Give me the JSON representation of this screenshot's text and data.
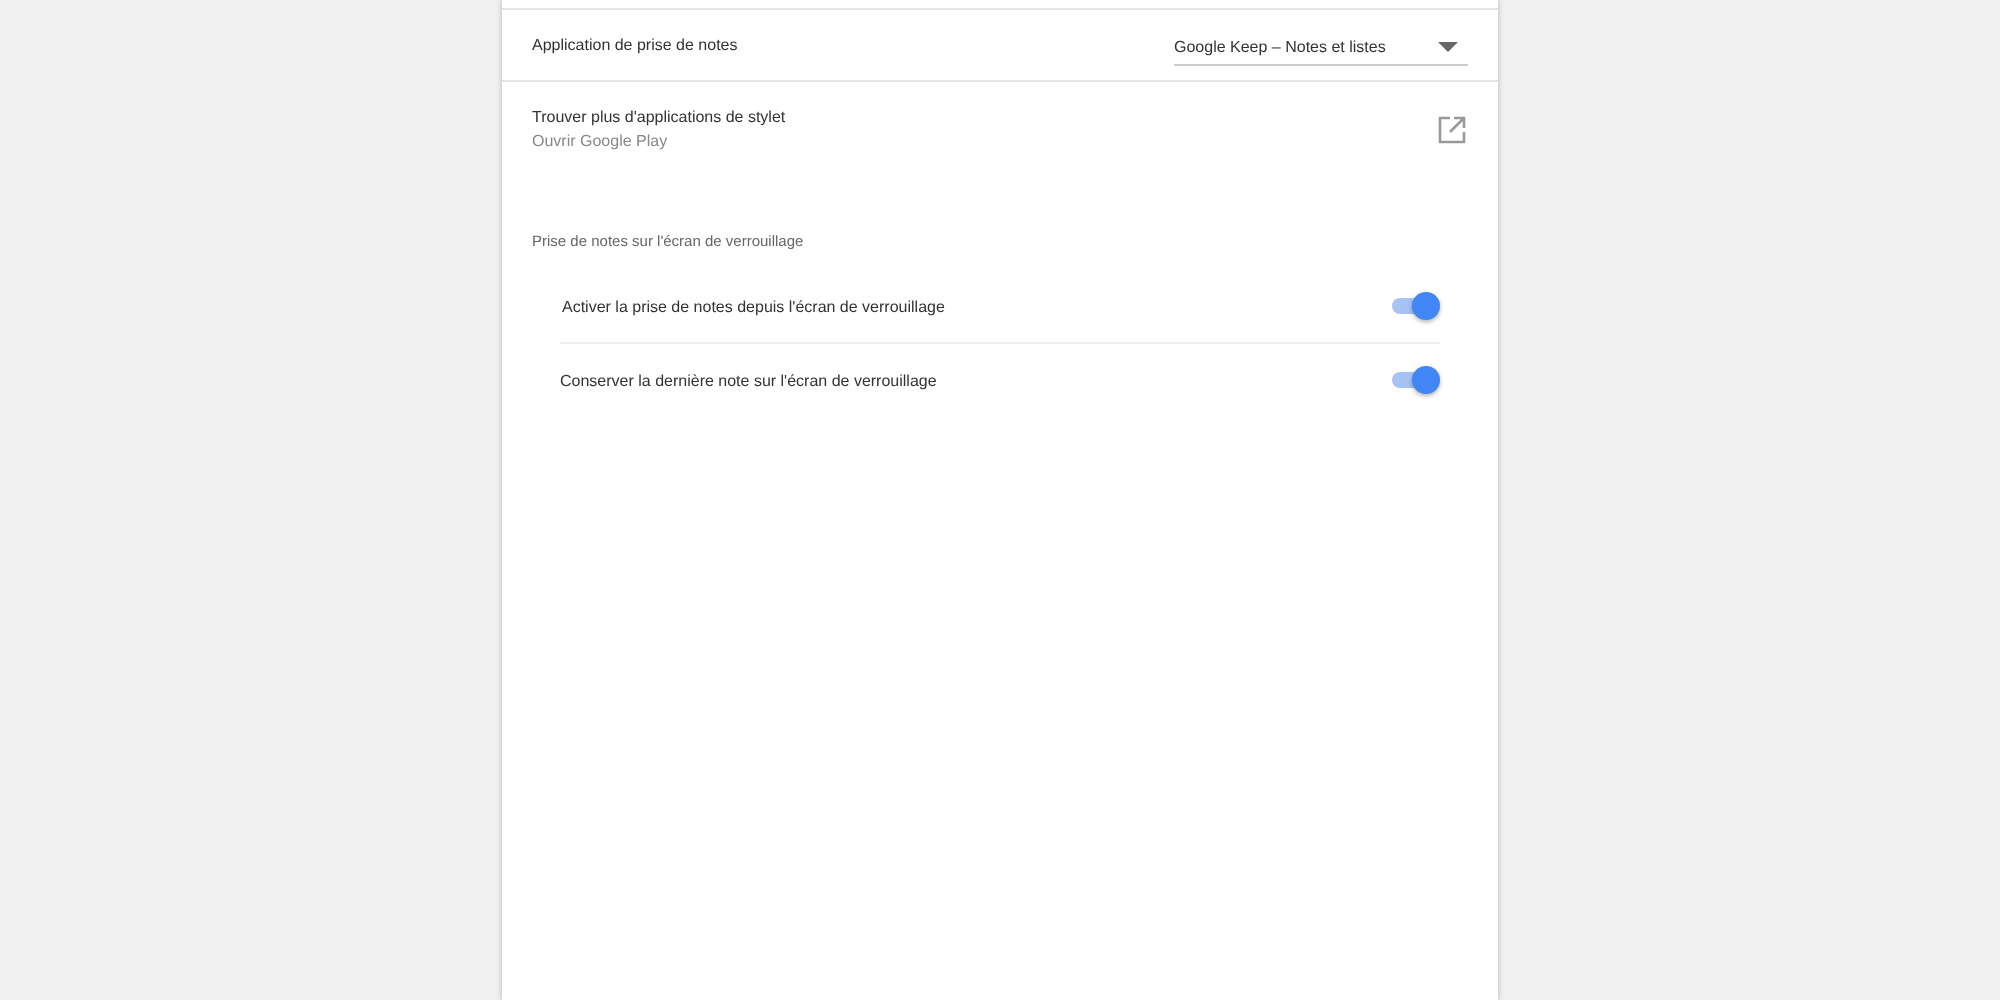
{
  "note_app": {
    "label": "Application de prise de notes",
    "value": "Google Keep – Notes et listes"
  },
  "find_more": {
    "title": "Trouver plus d'applications de stylet",
    "subtitle": "Ouvrir Google Play"
  },
  "lock_screen": {
    "heading": "Prise de notes sur l'écran de verrouillage",
    "toggles": [
      {
        "label": "Activer la prise de notes depuis l'écran de verrouillage",
        "on": true
      },
      {
        "label": "Conserver la dernière note sur l'écran de verrouillage",
        "on": true
      }
    ]
  }
}
